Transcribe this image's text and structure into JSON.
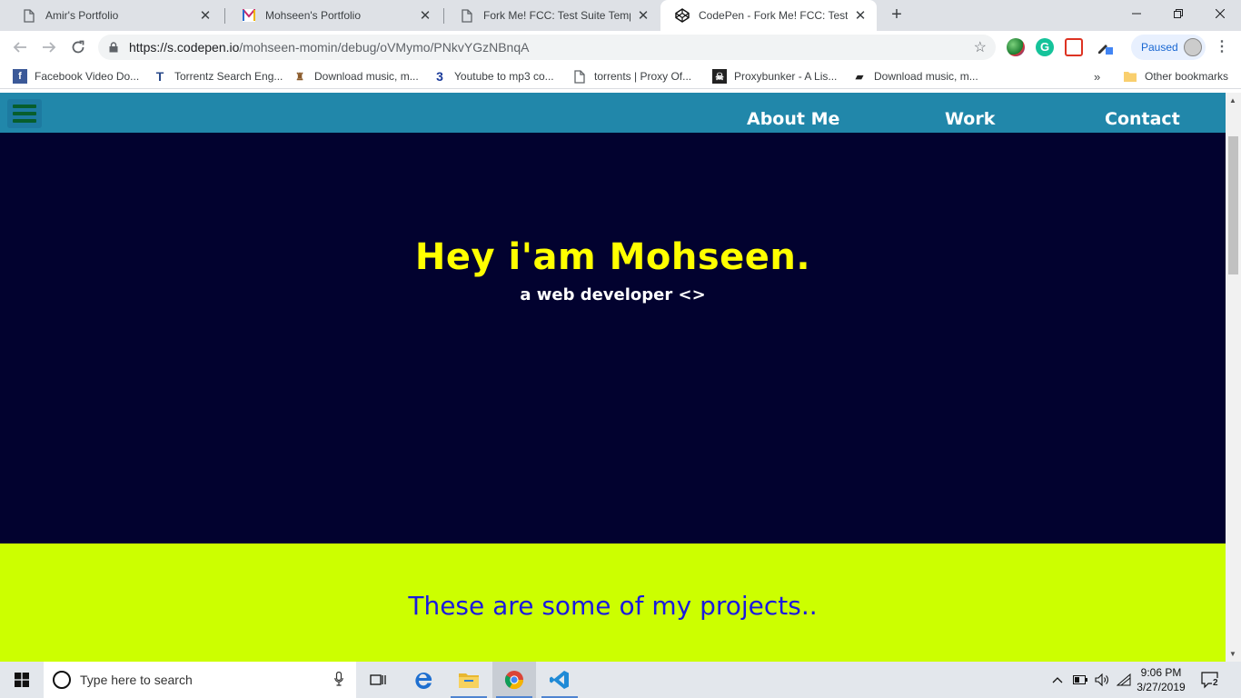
{
  "browser": {
    "tabs": [
      {
        "title": "Amir's Portfolio",
        "icon": "page-icon",
        "active": false
      },
      {
        "title": "Mohseen's Portfolio",
        "icon": "portfolio-m-icon",
        "active": false
      },
      {
        "title": "Fork Me! FCC: Test Suite Template",
        "icon": "page-icon",
        "active": false
      },
      {
        "title": "CodePen - Fork Me! FCC: Test Suite",
        "icon": "codepen-icon",
        "active": true
      }
    ],
    "new_tab_label": "+",
    "url_host": "https://s.codepen.io",
    "url_path": "/mohseen-momin/debug/oVMymo/PNkvYGzNBnqA",
    "profile_label": "Paused",
    "bookmarks": [
      {
        "label": "Facebook Video Do...",
        "icon": "facebook-icon"
      },
      {
        "label": "Torrentz Search Eng...",
        "icon": "torrentz-icon"
      },
      {
        "label": "Download music, m...",
        "icon": "music-download-icon"
      },
      {
        "label": "Youtube to mp3 co...",
        "icon": "mp3-converter-icon"
      },
      {
        "label": "torrents | Proxy Of...",
        "icon": "page-icon"
      },
      {
        "label": "Proxybunker - A Lis...",
        "icon": "proxybunker-icon"
      },
      {
        "label": "Download music, m...",
        "icon": "music-download-icon"
      }
    ],
    "more_bookmarks": "»",
    "other_bookmarks": "Other bookmarks"
  },
  "site": {
    "nav": [
      "About Me",
      "Work",
      "Contact"
    ],
    "hero_title": "Hey i'am Mohseen.",
    "hero_subtitle": "a web developer <>",
    "projects_heading": "These are some of my projects..",
    "colors": {
      "nav_bg": "#2187aa",
      "hero_bg": "#02022f",
      "hero_title": "#ffff00",
      "projects_bg": "#ccff00",
      "projects_heading": "#1a1adf"
    }
  },
  "taskbar": {
    "search_placeholder": "Type here to search",
    "time": "9:06 PM",
    "date": "3/27/2019",
    "notification_count": "2"
  }
}
